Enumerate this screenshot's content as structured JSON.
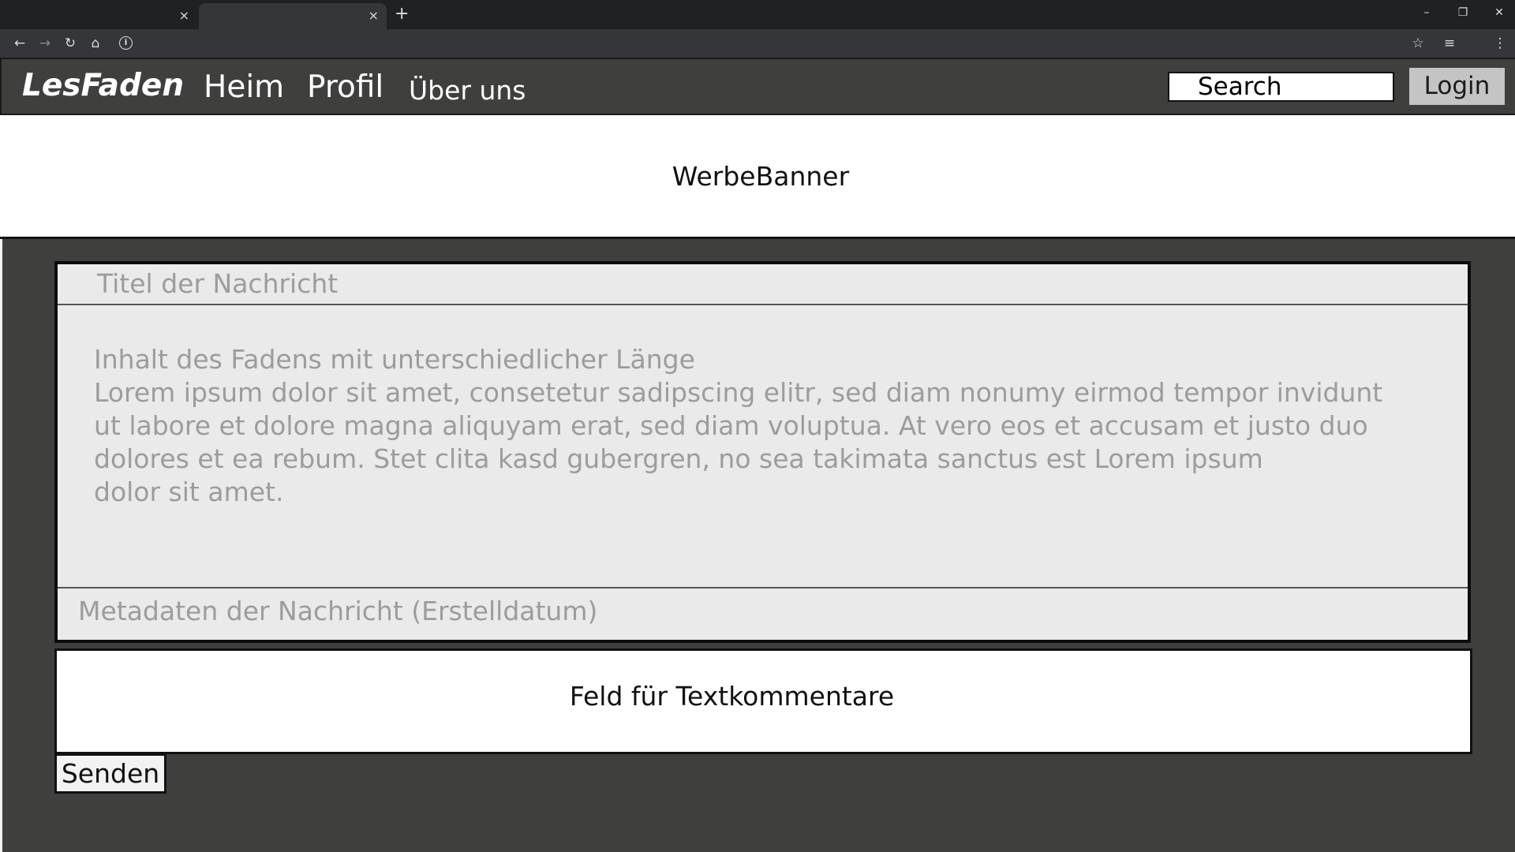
{
  "browser": {
    "tabs": [
      {
        "close": "×"
      },
      {
        "close": "×"
      }
    ],
    "new_tab": "+",
    "window_controls": {
      "minimize": "–",
      "restore": "❐",
      "close": "✕"
    },
    "toolbar_icons": [
      "back-icon",
      "forward-icon",
      "reload-icon",
      "home-icon",
      "info-icon",
      "star-icon",
      "reading-list-icon",
      "menu-icon"
    ],
    "glyphs": {
      "back": "←",
      "forward": "→",
      "reload": "↻",
      "home": "⌂",
      "info": "i",
      "star": "☆",
      "reading_list": "≡",
      "menu": "⋮"
    }
  },
  "nav": {
    "logo": "LesFaden",
    "links": [
      "Heim",
      "Profil",
      "Über uns"
    ],
    "search_placeholder": "Search",
    "login_label": "Login"
  },
  "banner": {
    "text": "WerbeBanner"
  },
  "post": {
    "title": "Titel der Nachricht",
    "body_lines": [
      "Inhalt des Fadens mit unterschiedlicher Länge",
      "Lorem ipsum dolor sit amet, consetetur sadipscing elitr, sed diam nonumy eirmod tempor invidunt",
      "ut labore et dolore magna aliquyam erat, sed diam voluptua. At vero eos et accusam et justo duo",
      "dolores et ea rebum. Stet clita kasd gubergren, no sea takimata sanctus est Lorem ipsum",
      "dolor sit amet."
    ],
    "meta": "Metadaten der Nachricht (Erstelldatum)"
  },
  "comment": {
    "placeholder": "Feld für Textkommentare",
    "send_label": "Senden"
  },
  "colors": {
    "page_bg": "#3f3f3e",
    "card_bg": "#e9eae9",
    "muted_text": "#9b9c9c",
    "login_bg": "#c4c4c4"
  }
}
